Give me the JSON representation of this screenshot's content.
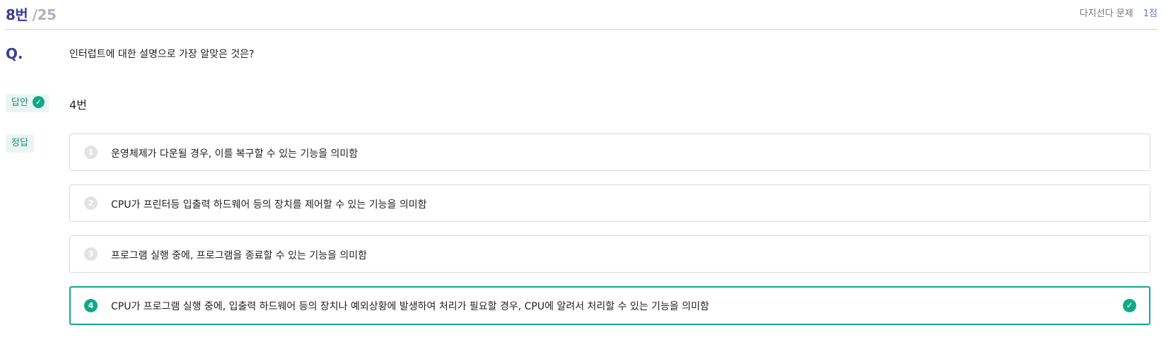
{
  "header": {
    "number": "8번",
    "total": "/25",
    "type": "다지선다 문제",
    "points": "1점"
  },
  "question": {
    "label": "Q.",
    "text": "인터럽트에 대한 설명으로 가장 알맞은 것은?"
  },
  "submitted": {
    "tag": "답안",
    "value": "4번",
    "status_icon": "check-circle-icon"
  },
  "correct": {
    "tag": "정답"
  },
  "choices": [
    {
      "num": "1",
      "text": "운영체제가 다운될 경우, 이를 복구할 수 있는 기능을 의미함"
    },
    {
      "num": "2",
      "text": "CPU가 프린터등 입출력 하드웨어 등의 장치를 제어할 수 있는 기능을 의미함"
    },
    {
      "num": "3",
      "text": "프로그램 실행 중에, 프로그램을 종료할 수 있는 기능을 의미함"
    },
    {
      "num": "4",
      "text": "CPU가 프로그램 실행 중에, 입출력 하드웨어 등의 장치나 예외상황에 발생하여 처리가 필요할 경우, CPU에 알려서 처리할 수 있는 기능을 의미함"
    }
  ],
  "selected_choice": "4",
  "colors": {
    "accent": "#3b3e97",
    "correct": "#11a985",
    "tag_bg": "#eaf5f2"
  }
}
